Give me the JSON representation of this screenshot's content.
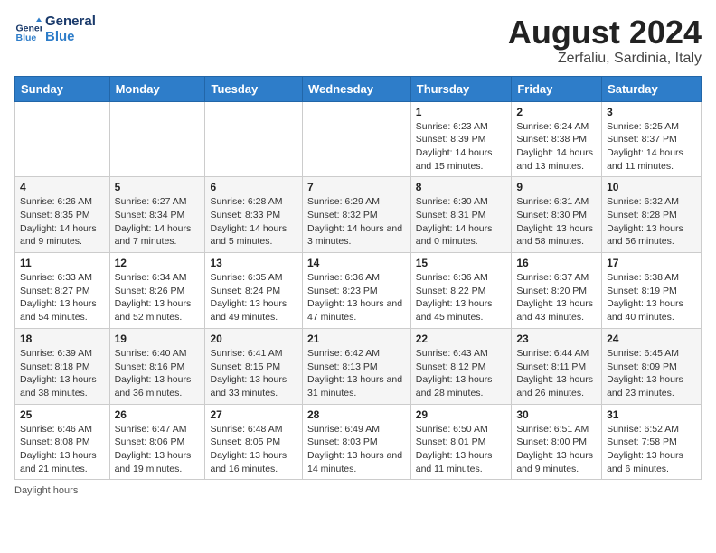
{
  "logo": {
    "line1": "General",
    "line2": "Blue"
  },
  "title": "August 2024",
  "subtitle": "Zerfaliu, Sardinia, Italy",
  "footer": "Daylight hours",
  "days_of_week": [
    "Sunday",
    "Monday",
    "Tuesday",
    "Wednesday",
    "Thursday",
    "Friday",
    "Saturday"
  ],
  "weeks": [
    [
      {
        "num": "",
        "info": ""
      },
      {
        "num": "",
        "info": ""
      },
      {
        "num": "",
        "info": ""
      },
      {
        "num": "",
        "info": ""
      },
      {
        "num": "1",
        "info": "Sunrise: 6:23 AM\nSunset: 8:39 PM\nDaylight: 14 hours and 15 minutes."
      },
      {
        "num": "2",
        "info": "Sunrise: 6:24 AM\nSunset: 8:38 PM\nDaylight: 14 hours and 13 minutes."
      },
      {
        "num": "3",
        "info": "Sunrise: 6:25 AM\nSunset: 8:37 PM\nDaylight: 14 hours and 11 minutes."
      }
    ],
    [
      {
        "num": "4",
        "info": "Sunrise: 6:26 AM\nSunset: 8:35 PM\nDaylight: 14 hours and 9 minutes."
      },
      {
        "num": "5",
        "info": "Sunrise: 6:27 AM\nSunset: 8:34 PM\nDaylight: 14 hours and 7 minutes."
      },
      {
        "num": "6",
        "info": "Sunrise: 6:28 AM\nSunset: 8:33 PM\nDaylight: 14 hours and 5 minutes."
      },
      {
        "num": "7",
        "info": "Sunrise: 6:29 AM\nSunset: 8:32 PM\nDaylight: 14 hours and 3 minutes."
      },
      {
        "num": "8",
        "info": "Sunrise: 6:30 AM\nSunset: 8:31 PM\nDaylight: 14 hours and 0 minutes."
      },
      {
        "num": "9",
        "info": "Sunrise: 6:31 AM\nSunset: 8:30 PM\nDaylight: 13 hours and 58 minutes."
      },
      {
        "num": "10",
        "info": "Sunrise: 6:32 AM\nSunset: 8:28 PM\nDaylight: 13 hours and 56 minutes."
      }
    ],
    [
      {
        "num": "11",
        "info": "Sunrise: 6:33 AM\nSunset: 8:27 PM\nDaylight: 13 hours and 54 minutes."
      },
      {
        "num": "12",
        "info": "Sunrise: 6:34 AM\nSunset: 8:26 PM\nDaylight: 13 hours and 52 minutes."
      },
      {
        "num": "13",
        "info": "Sunrise: 6:35 AM\nSunset: 8:24 PM\nDaylight: 13 hours and 49 minutes."
      },
      {
        "num": "14",
        "info": "Sunrise: 6:36 AM\nSunset: 8:23 PM\nDaylight: 13 hours and 47 minutes."
      },
      {
        "num": "15",
        "info": "Sunrise: 6:36 AM\nSunset: 8:22 PM\nDaylight: 13 hours and 45 minutes."
      },
      {
        "num": "16",
        "info": "Sunrise: 6:37 AM\nSunset: 8:20 PM\nDaylight: 13 hours and 43 minutes."
      },
      {
        "num": "17",
        "info": "Sunrise: 6:38 AM\nSunset: 8:19 PM\nDaylight: 13 hours and 40 minutes."
      }
    ],
    [
      {
        "num": "18",
        "info": "Sunrise: 6:39 AM\nSunset: 8:18 PM\nDaylight: 13 hours and 38 minutes."
      },
      {
        "num": "19",
        "info": "Sunrise: 6:40 AM\nSunset: 8:16 PM\nDaylight: 13 hours and 36 minutes."
      },
      {
        "num": "20",
        "info": "Sunrise: 6:41 AM\nSunset: 8:15 PM\nDaylight: 13 hours and 33 minutes."
      },
      {
        "num": "21",
        "info": "Sunrise: 6:42 AM\nSunset: 8:13 PM\nDaylight: 13 hours and 31 minutes."
      },
      {
        "num": "22",
        "info": "Sunrise: 6:43 AM\nSunset: 8:12 PM\nDaylight: 13 hours and 28 minutes."
      },
      {
        "num": "23",
        "info": "Sunrise: 6:44 AM\nSunset: 8:11 PM\nDaylight: 13 hours and 26 minutes."
      },
      {
        "num": "24",
        "info": "Sunrise: 6:45 AM\nSunset: 8:09 PM\nDaylight: 13 hours and 23 minutes."
      }
    ],
    [
      {
        "num": "25",
        "info": "Sunrise: 6:46 AM\nSunset: 8:08 PM\nDaylight: 13 hours and 21 minutes."
      },
      {
        "num": "26",
        "info": "Sunrise: 6:47 AM\nSunset: 8:06 PM\nDaylight: 13 hours and 19 minutes."
      },
      {
        "num": "27",
        "info": "Sunrise: 6:48 AM\nSunset: 8:05 PM\nDaylight: 13 hours and 16 minutes."
      },
      {
        "num": "28",
        "info": "Sunrise: 6:49 AM\nSunset: 8:03 PM\nDaylight: 13 hours and 14 minutes."
      },
      {
        "num": "29",
        "info": "Sunrise: 6:50 AM\nSunset: 8:01 PM\nDaylight: 13 hours and 11 minutes."
      },
      {
        "num": "30",
        "info": "Sunrise: 6:51 AM\nSunset: 8:00 PM\nDaylight: 13 hours and 9 minutes."
      },
      {
        "num": "31",
        "info": "Sunrise: 6:52 AM\nSunset: 7:58 PM\nDaylight: 13 hours and 6 minutes."
      }
    ]
  ]
}
